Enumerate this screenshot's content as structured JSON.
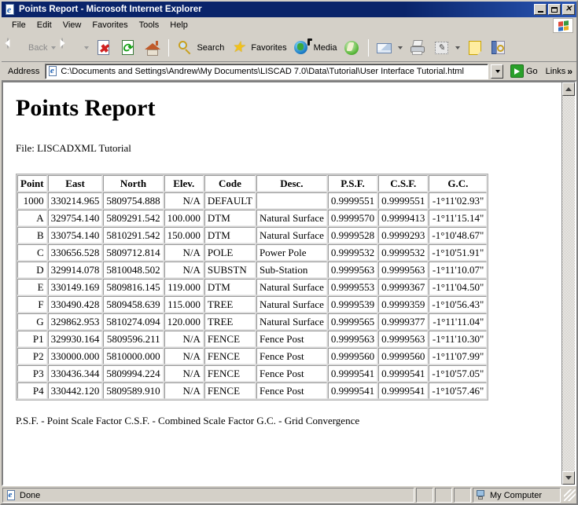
{
  "window": {
    "title": "Points Report - Microsoft Internet Explorer",
    "app_icon": "ie-page-icon",
    "minimize_label": "_",
    "maximize_label": "□",
    "close_label": "✕"
  },
  "menubar": {
    "items": [
      {
        "label": "File"
      },
      {
        "label": "Edit"
      },
      {
        "label": "View"
      },
      {
        "label": "Favorites"
      },
      {
        "label": "Tools"
      },
      {
        "label": "Help"
      }
    ],
    "brand_icon": "windows-flag-icon"
  },
  "toolbar": {
    "back_label": "Back",
    "back_icon": "back-arrow-icon",
    "forward_icon": "forward-arrow-icon",
    "stop_icon": "stop-icon",
    "refresh_icon": "refresh-icon",
    "home_icon": "home-icon",
    "search_label": "Search",
    "search_icon": "search-magnifier-icon",
    "favorites_label": "Favorites",
    "favorites_icon": "star-icon",
    "media_label": "Media",
    "media_icon": "globe-media-icon",
    "history_icon": "history-swirl-icon",
    "mail_icon": "mail-icon",
    "print_icon": "printer-icon",
    "edit_icon": "edit-page-icon",
    "discuss_icon": "notes-icon",
    "research_icon": "research-book-icon"
  },
  "addressbar": {
    "label": "Address",
    "value": "C:\\Documents and Settings\\Andrew\\My Documents\\LISCAD 7.0\\Data\\Tutorial\\User Interface Tutorial.html",
    "placeholder": "",
    "page_icon": "ie-page-icon",
    "dropdown_icon": "chevron-down-icon",
    "go_label": "Go",
    "go_icon": "go-arrow-icon",
    "links_label": "Links",
    "links_chevron": "»"
  },
  "document": {
    "heading": "Points Report",
    "file_line": "File: LISCADXML Tutorial",
    "footer_note": "P.S.F. - Point Scale Factor   C.S.F. - Combined Scale Factor   G.C. - Grid Convergence",
    "table": {
      "headers": [
        "Point",
        "East",
        "North",
        "Elev.",
        "Code",
        "Desc.",
        "P.S.F.",
        "C.S.F.",
        "G.C."
      ],
      "rows": [
        [
          "1000",
          "330214.965",
          "5809754.888",
          "N/A",
          "DEFAULT",
          "",
          "0.9999551",
          "0.9999551",
          "-1°11'02.93\""
        ],
        [
          "A",
          "329754.140",
          "5809291.542",
          "100.000",
          "DTM",
          "Natural Surface",
          "0.9999570",
          "0.9999413",
          "-1°11'15.14\""
        ],
        [
          "B",
          "330754.140",
          "5810291.542",
          "150.000",
          "DTM",
          "Natural Surface",
          "0.9999528",
          "0.9999293",
          "-1°10'48.67\""
        ],
        [
          "C",
          "330656.528",
          "5809712.814",
          "N/A",
          "POLE",
          "Power Pole",
          "0.9999532",
          "0.9999532",
          "-1°10'51.91\""
        ],
        [
          "D",
          "329914.078",
          "5810048.502",
          "N/A",
          "SUBSTN",
          "Sub-Station",
          "0.9999563",
          "0.9999563",
          "-1°11'10.07\""
        ],
        [
          "E",
          "330149.169",
          "5809816.145",
          "119.000",
          "DTM",
          "Natural Surface",
          "0.9999553",
          "0.9999367",
          "-1°11'04.50\""
        ],
        [
          "F",
          "330490.428",
          "5809458.639",
          "115.000",
          "TREE",
          "Natural Surface",
          "0.9999539",
          "0.9999359",
          "-1°10'56.43\""
        ],
        [
          "G",
          "329862.953",
          "5810274.094",
          "120.000",
          "TREE",
          "Natural Surface",
          "0.9999565",
          "0.9999377",
          "-1°11'11.04\""
        ],
        [
          "P1",
          "329930.164",
          "5809596.211",
          "N/A",
          "FENCE",
          "Fence Post",
          "0.9999563",
          "0.9999563",
          "-1°11'10.30\""
        ],
        [
          "P2",
          "330000.000",
          "5810000.000",
          "N/A",
          "FENCE",
          "Fence Post",
          "0.9999560",
          "0.9999560",
          "-1°11'07.99\""
        ],
        [
          "P3",
          "330436.344",
          "5809994.224",
          "N/A",
          "FENCE",
          "Fence Post",
          "0.9999541",
          "0.9999541",
          "-1°10'57.05\""
        ],
        [
          "P4",
          "330442.120",
          "5809589.910",
          "N/A",
          "FENCE",
          "Fence Post",
          "0.9999541",
          "0.9999541",
          "-1°10'57.46\""
        ]
      ]
    }
  },
  "scrollbar": {
    "up_icon": "scroll-up-arrow-icon",
    "down_icon": "scroll-down-arrow-icon"
  },
  "statusbar": {
    "status_text": "Done",
    "status_icon": "ie-page-icon",
    "zone_text": "My Computer",
    "zone_icon": "my-computer-icon"
  },
  "colors": {
    "titlebar": "#0a246a",
    "chrome": "#d4d0c8",
    "page_bg": "#ffffff",
    "go_green": "#2aa02a"
  }
}
